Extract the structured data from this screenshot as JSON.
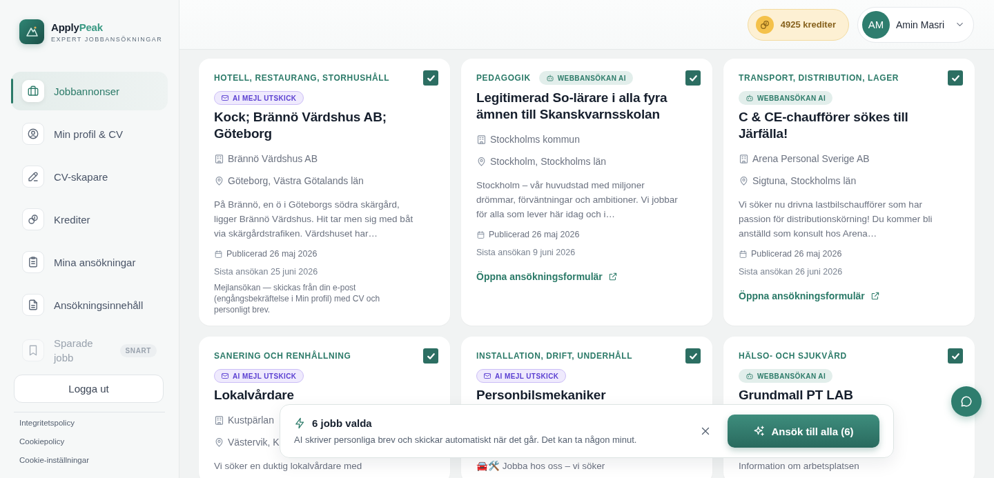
{
  "brand": {
    "name_parts": [
      "Apply",
      "Peak"
    ],
    "tagline": "EXPERT JOBBANSÖKNINGAR"
  },
  "sidebar": {
    "nav": [
      {
        "label": "Jobbannonser",
        "selected": true,
        "disabled": false
      },
      {
        "label": "Min profil & CV",
        "selected": false,
        "disabled": false
      },
      {
        "label": "CV-skapare",
        "selected": false,
        "disabled": false
      },
      {
        "label": "Krediter",
        "selected": false,
        "disabled": false
      },
      {
        "label": "Mina ansökningar",
        "selected": false,
        "disabled": false
      },
      {
        "label": "Ansökningsinnehåll",
        "selected": false,
        "disabled": false
      },
      {
        "label": "Sparade jobb",
        "selected": false,
        "disabled": true,
        "badge": "SNART"
      }
    ],
    "logout": "Logga ut",
    "footer_links": [
      "Integritetspolicy",
      "Cookiepolicy",
      "Cookie-inställningar"
    ]
  },
  "header": {
    "credits": "4925 krediter",
    "user": {
      "initials": "AM",
      "name": "Amin Masri"
    }
  },
  "cards": [
    {
      "category": "HOTELL, RESTAURANG, STORHUSHÅLL",
      "tag": {
        "kind": "email",
        "label": "AI MEJL UTSKICK"
      },
      "title": "Kock; Brännö Värdshus AB; Göteborg",
      "company": "Brännö Värdshus AB",
      "location": "Göteborg, Västra Götalands län",
      "description": "På Brännö, en ö i Göteborgs södra skärgård, ligger Brännö Värdshus. Hit tar men sig med båt via skärgårdstrafiken. Värdshuset har…",
      "published": "Publicerad 26 maj 2026",
      "deadline": "Sista ansökan 25 juni 2026",
      "note": "Mejlansökan — skickas från din e-post (engångsbekräftelse i Min profil) med CV och personligt brev.",
      "selected": true
    },
    {
      "category": "PEDAGOGIK",
      "tag": {
        "kind": "web",
        "label": "WEBBANSÖKAN AI"
      },
      "title": "Legitimerad So-lärare i alla fyra ämnen till Skanskvarnsskolan",
      "company": "Stockholms kommun",
      "location": "Stockholm, Stockholms län",
      "description": "Stockholm – vår huvudstad med miljoner drömmar, förväntningar och ambitioner. Vi jobbar för alla som lever här idag och i…",
      "published": "Publicerad 26 maj 2026",
      "deadline": "Sista ansökan 9 juni 2026",
      "link": "Öppna ansökningsformulär",
      "selected": true
    },
    {
      "category": "TRANSPORT, DISTRIBUTION, LAGER",
      "tag": {
        "kind": "web",
        "label": "WEBBANSÖKAN AI"
      },
      "title": "C & CE-chaufförer sökes till Järfälla!",
      "company": "Arena Personal Sverige AB",
      "location": "Sigtuna, Stockholms län",
      "description": "Vi söker nu drivna lastbilschaufförer som har passion för distributionskörning! Du kommer bli anställd som konsult hos Arena…",
      "published": "Publicerad 26 maj 2026",
      "deadline": "Sista ansökan 26 juni 2026",
      "link": "Öppna ansökningsformulär",
      "selected": true
    },
    {
      "category": "SANERING OCH RENHÅLLNING",
      "tag": {
        "kind": "email",
        "label": "AI MEJL UTSKICK"
      },
      "title": "Lokalvårdare",
      "company": "Kustpärlan",
      "location": "Västervik, K",
      "description": "Vi söker en duktig lokalvårdare med",
      "selected": true
    },
    {
      "category": "INSTALLATION, DRIFT, UNDERHÅLL",
      "tag": {
        "kind": "email",
        "label": "AI MEJL UTSKICK"
      },
      "title": "Personbilsmekaniker",
      "description": "🚘🛠️ Jobba hos oss – vi söker",
      "selected": true
    },
    {
      "category": "HÄLSO- OCH SJUKVÅRD",
      "tag": {
        "kind": "web",
        "label": "WEBBANSÖKAN AI"
      },
      "title": "Grundmall PT LAB",
      "description": "Information om arbetsplatsen",
      "selected": true
    }
  ],
  "selection_bar": {
    "title": "6 jobb valda",
    "text": "AI skriver personliga brev och skickar automatiskt när det går. Det kan ta någon minut.",
    "apply_button": "Ansök till alla (6)"
  }
}
